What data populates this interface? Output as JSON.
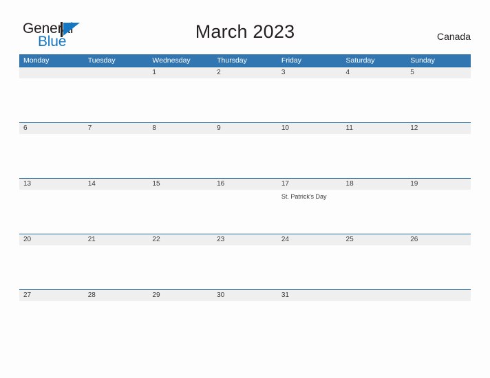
{
  "brand": {
    "name_part1": "General",
    "name_part2": "Blue",
    "mark": "triangle-logo",
    "color_blue": "#1577c2",
    "color_dark": "#231f20"
  },
  "header": {
    "title": "March 2023",
    "region": "Canada"
  },
  "theme": {
    "header_blue": "#3276b1",
    "row_band_grey": "#efefef",
    "row_band_line": "#20689e",
    "page_background": "#fdfdfd",
    "text_color": "#3b3b3b"
  },
  "calendar": {
    "weekdays": [
      "Monday",
      "Tuesday",
      "Wednesday",
      "Thursday",
      "Friday",
      "Saturday",
      "Sunday"
    ],
    "weeks": [
      [
        {
          "date": "",
          "events": []
        },
        {
          "date": "",
          "events": []
        },
        {
          "date": "1",
          "events": []
        },
        {
          "date": "2",
          "events": []
        },
        {
          "date": "3",
          "events": []
        },
        {
          "date": "4",
          "events": []
        },
        {
          "date": "5",
          "events": []
        }
      ],
      [
        {
          "date": "6",
          "events": []
        },
        {
          "date": "7",
          "events": []
        },
        {
          "date": "8",
          "events": []
        },
        {
          "date": "9",
          "events": []
        },
        {
          "date": "10",
          "events": []
        },
        {
          "date": "11",
          "events": []
        },
        {
          "date": "12",
          "events": []
        }
      ],
      [
        {
          "date": "13",
          "events": []
        },
        {
          "date": "14",
          "events": []
        },
        {
          "date": "15",
          "events": []
        },
        {
          "date": "16",
          "events": []
        },
        {
          "date": "17",
          "events": [
            "St. Patrick's Day"
          ]
        },
        {
          "date": "18",
          "events": []
        },
        {
          "date": "19",
          "events": []
        }
      ],
      [
        {
          "date": "20",
          "events": []
        },
        {
          "date": "21",
          "events": []
        },
        {
          "date": "22",
          "events": []
        },
        {
          "date": "23",
          "events": []
        },
        {
          "date": "24",
          "events": []
        },
        {
          "date": "25",
          "events": []
        },
        {
          "date": "26",
          "events": []
        }
      ],
      [
        {
          "date": "27",
          "events": []
        },
        {
          "date": "28",
          "events": []
        },
        {
          "date": "29",
          "events": []
        },
        {
          "date": "30",
          "events": []
        },
        {
          "date": "31",
          "events": []
        },
        {
          "date": "",
          "events": []
        },
        {
          "date": "",
          "events": []
        }
      ]
    ]
  }
}
